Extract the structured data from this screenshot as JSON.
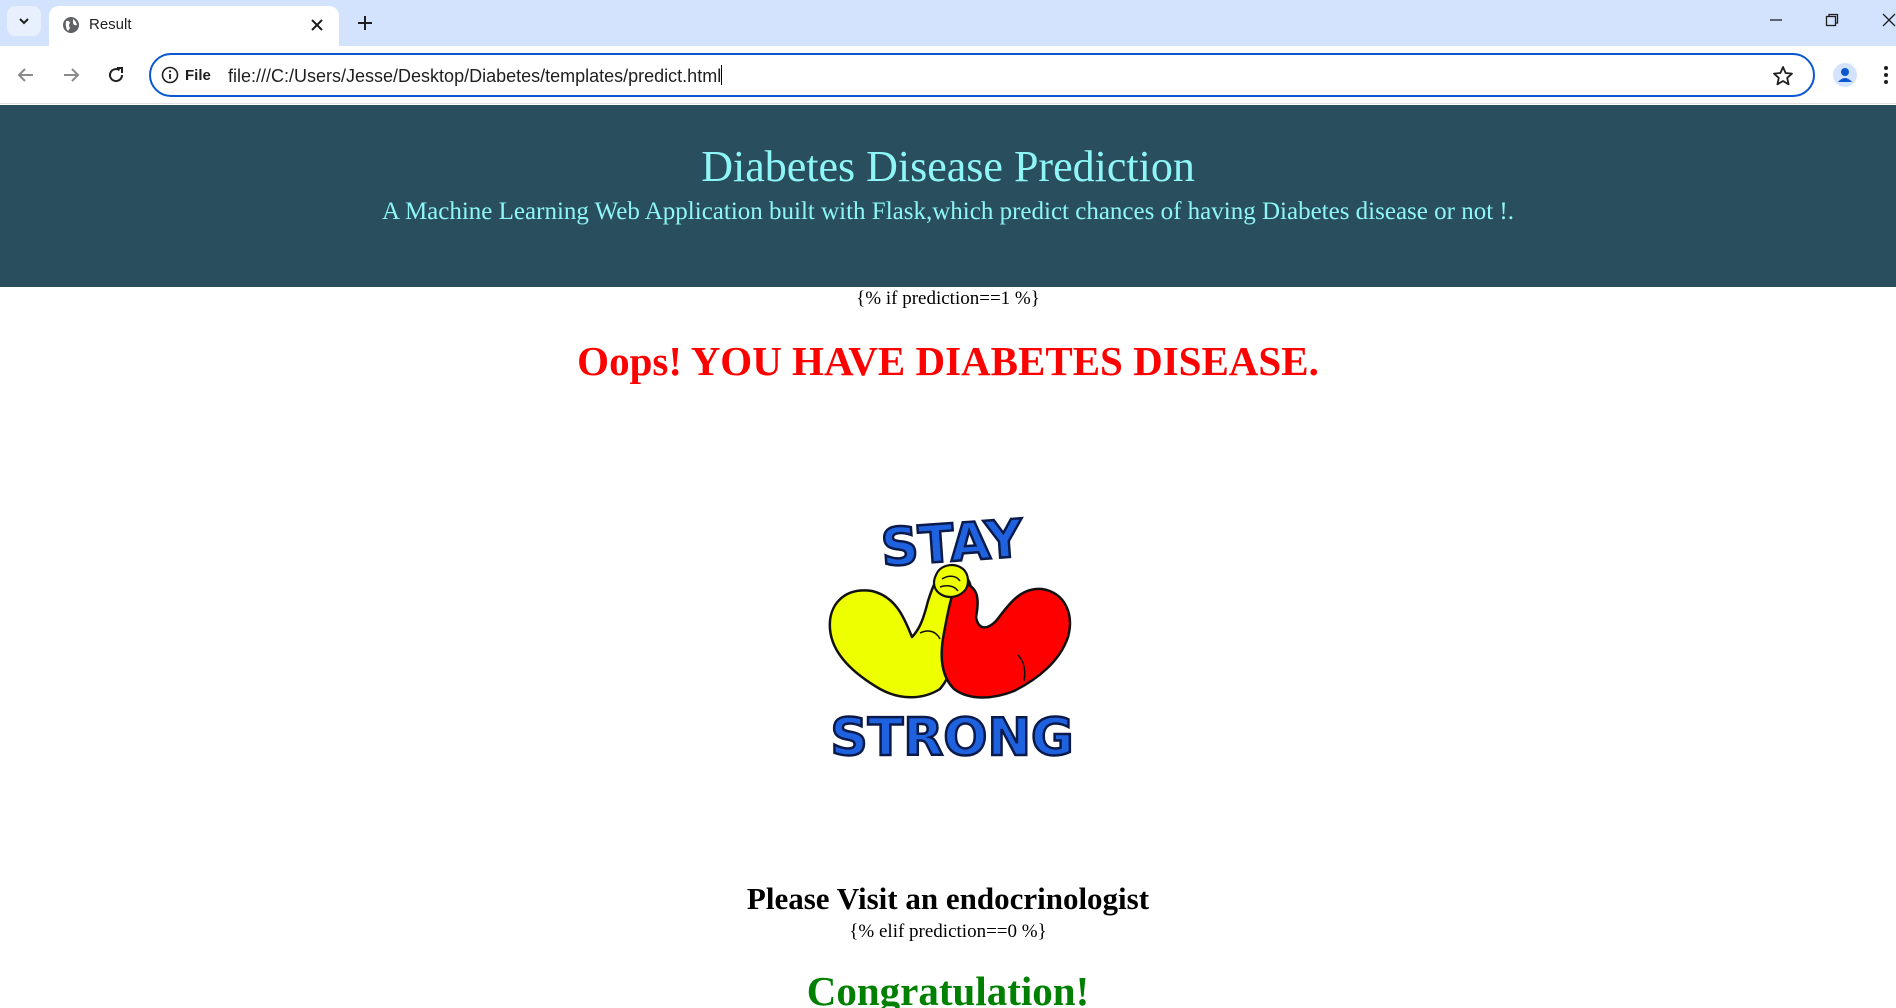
{
  "browser": {
    "tab_title": "Result",
    "site_chip_label": "File",
    "url": "file:///C:/Users/Jesse/Desktop/Diabetes/templates/predict.html"
  },
  "header": {
    "title": "Diabetes Disease Prediction",
    "subtitle": "A Machine Learning Web Application built with Flask,which predict chances of having Diabetes disease or not !."
  },
  "result": {
    "template_if": "{% if prediction==1 %}",
    "positive_message": "Oops! YOU HAVE DIABETES DISEASE.",
    "logo_top_text": "STAY",
    "logo_bottom_text": "STRONG",
    "advice": "Please Visit an endocrinologist",
    "template_elif": "{% elif prediction==0 %}",
    "negative_message": "Congratulation!"
  },
  "colors": {
    "header_bg": "#294f5e",
    "header_text": "#8ff6f8",
    "positive_message": "#ff0000",
    "negative_message": "#008000",
    "omnibox_border": "#0b57d0",
    "tabstrip_bg": "#d3e3fd"
  }
}
